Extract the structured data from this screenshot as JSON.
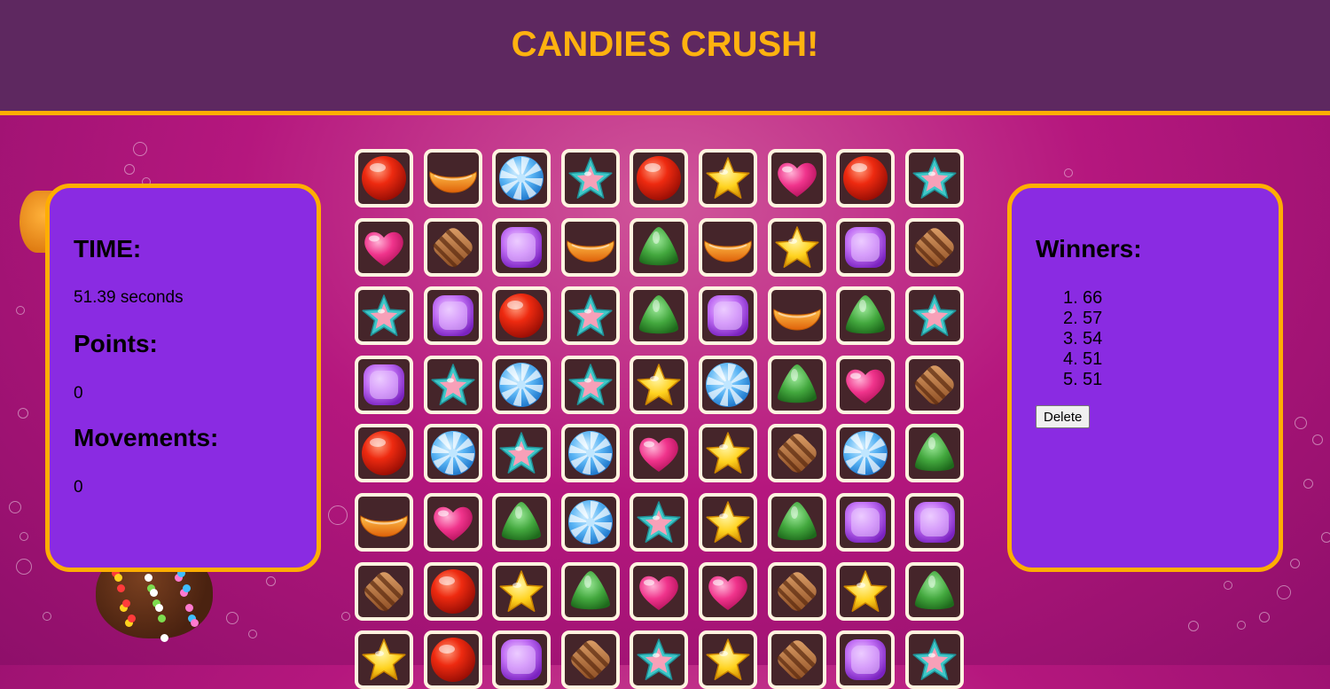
{
  "header": {
    "title": "CANDIES CRUSH!"
  },
  "stats": {
    "time_label": "TIME:",
    "time_value": "51.39 seconds",
    "points_label": "Points:",
    "points_value": "0",
    "movements_label": "Movements:",
    "movements_value": "0"
  },
  "winners": {
    "label": "Winners:",
    "items": [
      {
        "rank": "1.",
        "score": "66"
      },
      {
        "rank": "2.",
        "score": "57"
      },
      {
        "rank": "3.",
        "score": "54"
      },
      {
        "rank": "4.",
        "score": "51"
      },
      {
        "rank": "5.",
        "score": "51"
      }
    ],
    "delete_label": "Delete"
  },
  "board": {
    "columns": 9,
    "rows": [
      [
        "red-candy",
        "orange-candy",
        "blue-candy",
        "teal-star-candy",
        "red-candy",
        "yellow-star-candy",
        "pink-heart-candy",
        "red-candy",
        "teal-star-candy"
      ],
      [
        "pink-heart-candy",
        "brown-candy",
        "purple-candy",
        "orange-candy",
        "green-candy",
        "orange-candy",
        "yellow-star-candy",
        "purple-candy",
        "brown-candy"
      ],
      [
        "teal-star-candy",
        "purple-candy",
        "red-candy",
        "teal-star-candy",
        "green-candy",
        "purple-candy",
        "orange-candy",
        "green-candy",
        "teal-star-candy"
      ],
      [
        "purple-candy",
        "teal-star-candy",
        "blue-candy",
        "teal-star-candy",
        "yellow-star-candy",
        "blue-candy",
        "green-candy",
        "pink-heart-candy",
        "brown-candy"
      ],
      [
        "red-candy",
        "blue-candy",
        "teal-star-candy",
        "blue-candy",
        "pink-heart-candy",
        "yellow-star-candy",
        "brown-candy",
        "blue-candy",
        "green-candy"
      ],
      [
        "orange-candy",
        "pink-heart-candy",
        "green-candy",
        "blue-candy",
        "teal-star-candy",
        "yellow-star-candy",
        "green-candy",
        "purple-candy",
        "purple-candy"
      ],
      [
        "brown-candy",
        "red-candy",
        "yellow-star-candy",
        "green-candy",
        "pink-heart-candy",
        "pink-heart-candy",
        "brown-candy",
        "yellow-star-candy",
        "green-candy"
      ],
      [
        "yellow-star-candy",
        "red-candy",
        "purple-candy",
        "brown-candy",
        "teal-star-candy",
        "yellow-star-candy",
        "brown-candy",
        "purple-candy",
        "teal-star-candy"
      ]
    ]
  },
  "colors": {
    "header_bg": "#5e2860",
    "accent": "#ffae00",
    "title": "#ffb20f",
    "panel_bg": "#8a2be2",
    "cell_bg": "#45252a",
    "cell_border": "#fff4e0"
  }
}
